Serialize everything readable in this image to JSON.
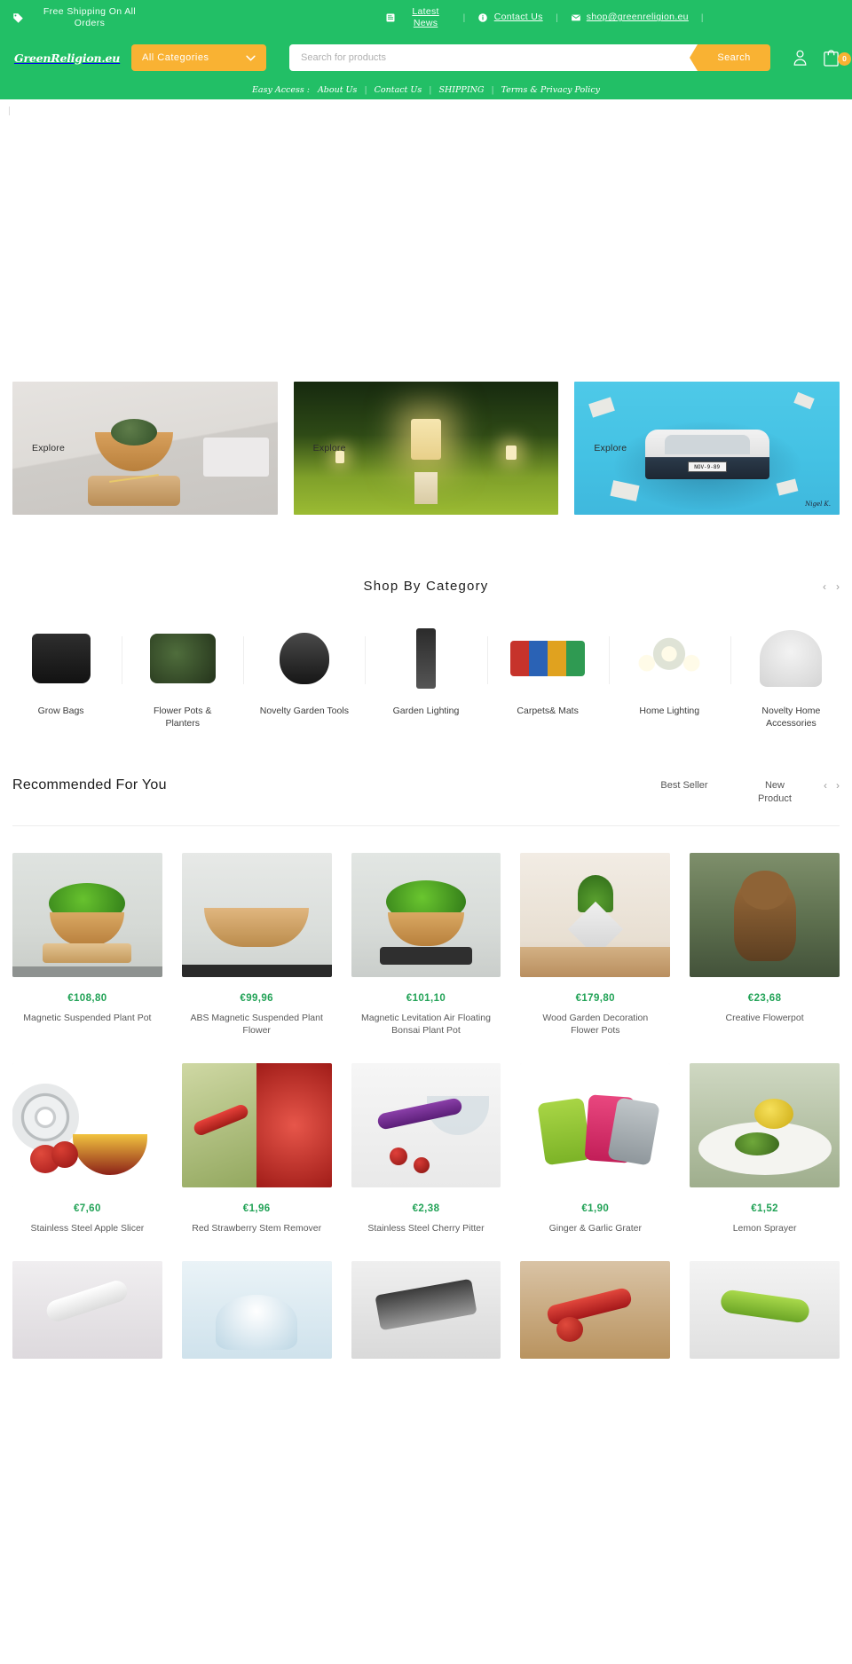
{
  "topbar": {
    "tag_icon": "tag-icon",
    "shipping_text": "Free Shipping On All Orders",
    "links": [
      {
        "icon": "news-icon",
        "label": "Latest News"
      },
      {
        "icon": "info-icon",
        "label": "Contact Us"
      },
      {
        "icon": "mail-icon",
        "label": "shop@greenreligion.eu"
      }
    ],
    "separator": "|"
  },
  "header": {
    "logo_text": "GreenReligion.eu",
    "logo_icon": "leaf-logo-icon",
    "category_select": {
      "value": "All Categories",
      "icon": "chevron-down-icon"
    },
    "search": {
      "placeholder": "Search for products",
      "value": "",
      "button_label": "Search"
    },
    "account_icon": "user-icon",
    "cart_icon": "shopping-bag-icon",
    "cart_count": "0"
  },
  "easy_access": {
    "lead": "Easy Access :",
    "links": [
      "About Us",
      "Contact Us",
      "SHIPPING",
      "Terms & Privacy Policy"
    ],
    "separator": "|"
  },
  "banners": [
    {
      "label": "Explore",
      "name": "banner-levitating-plant-pot"
    },
    {
      "label": "Explore",
      "name": "banner-garden-lighting"
    },
    {
      "label": "Explore",
      "name": "banner-wall-art-car"
    }
  ],
  "banner_art": {
    "car_plate": "NOV-9-89",
    "signature": "Nigel K."
  },
  "shop_by_category": {
    "title": "Shop By Category",
    "prev_arrow": "‹",
    "next_arrow": "›",
    "items": [
      {
        "label": "Grow Bags",
        "thumb": "grow-bag-thumb"
      },
      {
        "label": "Flower Pots & Planters",
        "thumb": "flower-pot-thumb"
      },
      {
        "label": "Novelty Garden Tools",
        "thumb": "novelty-garden-tool-thumb"
      },
      {
        "label": "Garden Lighting",
        "thumb": "garden-light-thumb"
      },
      {
        "label": "Carpets& Mats",
        "thumb": "carpet-mat-thumb"
      },
      {
        "label": "Home Lighting",
        "thumb": "home-light-thumb"
      },
      {
        "label": "Novelty Home Accessories",
        "thumb": "novelty-home-thumb"
      }
    ]
  },
  "recommended": {
    "title": "Recommended For You",
    "tabs": [
      "Best Seller",
      "New Product"
    ],
    "prev_arrow": "‹",
    "next_arrow": "›",
    "products_row1": [
      {
        "price": "€108,80",
        "name": "Magnetic Suspended Plant Pot"
      },
      {
        "price": "€99,96",
        "name": "ABS Magnetic Suspended Plant Flower"
      },
      {
        "price": "€101,10",
        "name": "Magnetic Levitation Air Floating Bonsai Plant Pot"
      },
      {
        "price": "€179,80",
        "name": "Wood Garden Decoration Flower Pots"
      },
      {
        "price": "€23,68",
        "name": "Creative Flowerpot"
      }
    ],
    "products_row2": [
      {
        "price": "€7,60",
        "name": "Stainless Steel Apple Slicer"
      },
      {
        "price": "€1,96",
        "name": "Red Strawberry Stem Remover"
      },
      {
        "price": "€2,38",
        "name": "Stainless Steel Cherry Pitter"
      },
      {
        "price": "€1,90",
        "name": "Ginger & Garlic Grater"
      },
      {
        "price": "€1,52",
        "name": "Lemon Sprayer"
      }
    ],
    "products_row3": [
      {
        "price": "",
        "name": ""
      },
      {
        "price": "",
        "name": ""
      },
      {
        "price": "",
        "name": ""
      },
      {
        "price": "",
        "name": ""
      },
      {
        "price": "",
        "name": ""
      }
    ]
  },
  "colors": {
    "brand_green": "#22bf66",
    "accent_orange": "#f9b233",
    "price_green": "#21a256"
  }
}
